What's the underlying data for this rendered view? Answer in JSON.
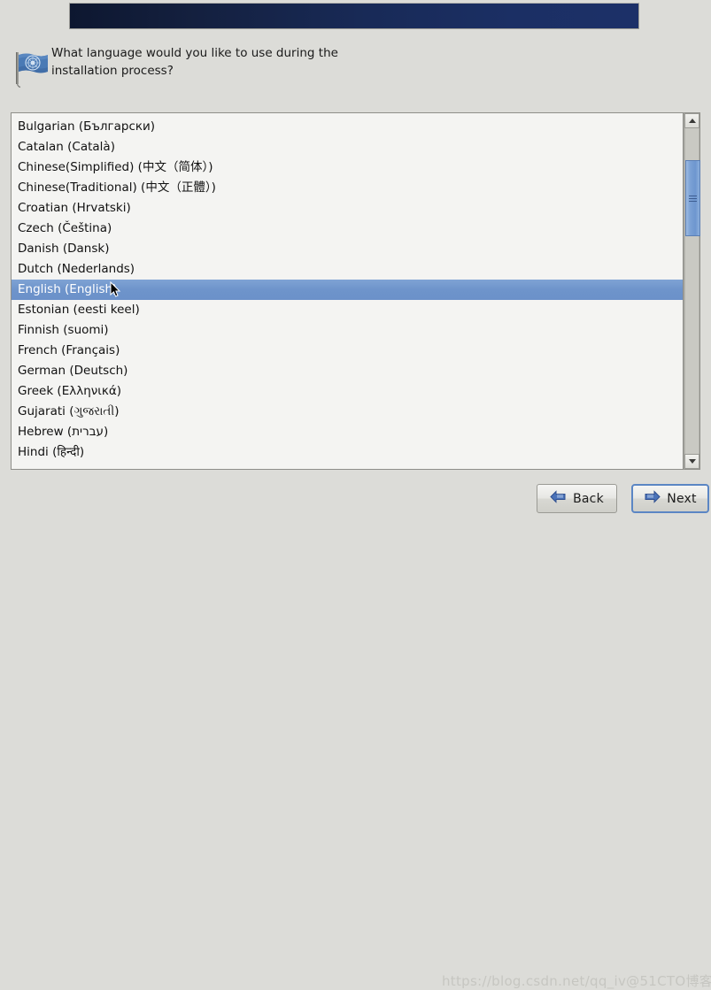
{
  "window": {
    "background_color": "#dcdcd8",
    "banner_color": "#182a57"
  },
  "header": {
    "icon": "un-flag-icon",
    "question": "What language would you like to use during the\ninstallation process?"
  },
  "language_list": {
    "selected": "English (English)",
    "items": [
      "Bulgarian (Български)",
      "Catalan (Català)",
      "Chinese(Simplified) (中文（简体）)",
      "Chinese(Traditional) (中文（正體）)",
      "Croatian (Hrvatski)",
      "Czech (Čeština)",
      "Danish (Dansk)",
      "Dutch (Nederlands)",
      "English (English)",
      "Estonian (eesti keel)",
      "Finnish (suomi)",
      "French (Français)",
      "German (Deutsch)",
      "Greek (Ελληνικά)",
      "Gujarati (ગુજરાતી)",
      "Hebrew (עברית)",
      "Hindi (हिन्दी)"
    ],
    "selection_color": "#6b91c9"
  },
  "scrollbar": {
    "up_arrow": "chevron-up-icon",
    "down_arrow": "chevron-down-icon",
    "thumb_color": "#7ba1d5"
  },
  "footer": {
    "back_label": "Back",
    "back_icon": "arrow-left-icon",
    "next_label": "Next",
    "next_icon": "arrow-right-icon",
    "next_focus_color": "#5b86c4"
  },
  "watermark": {
    "text": "https://blog.csdn.net/qq_iv@51CTO博客"
  }
}
